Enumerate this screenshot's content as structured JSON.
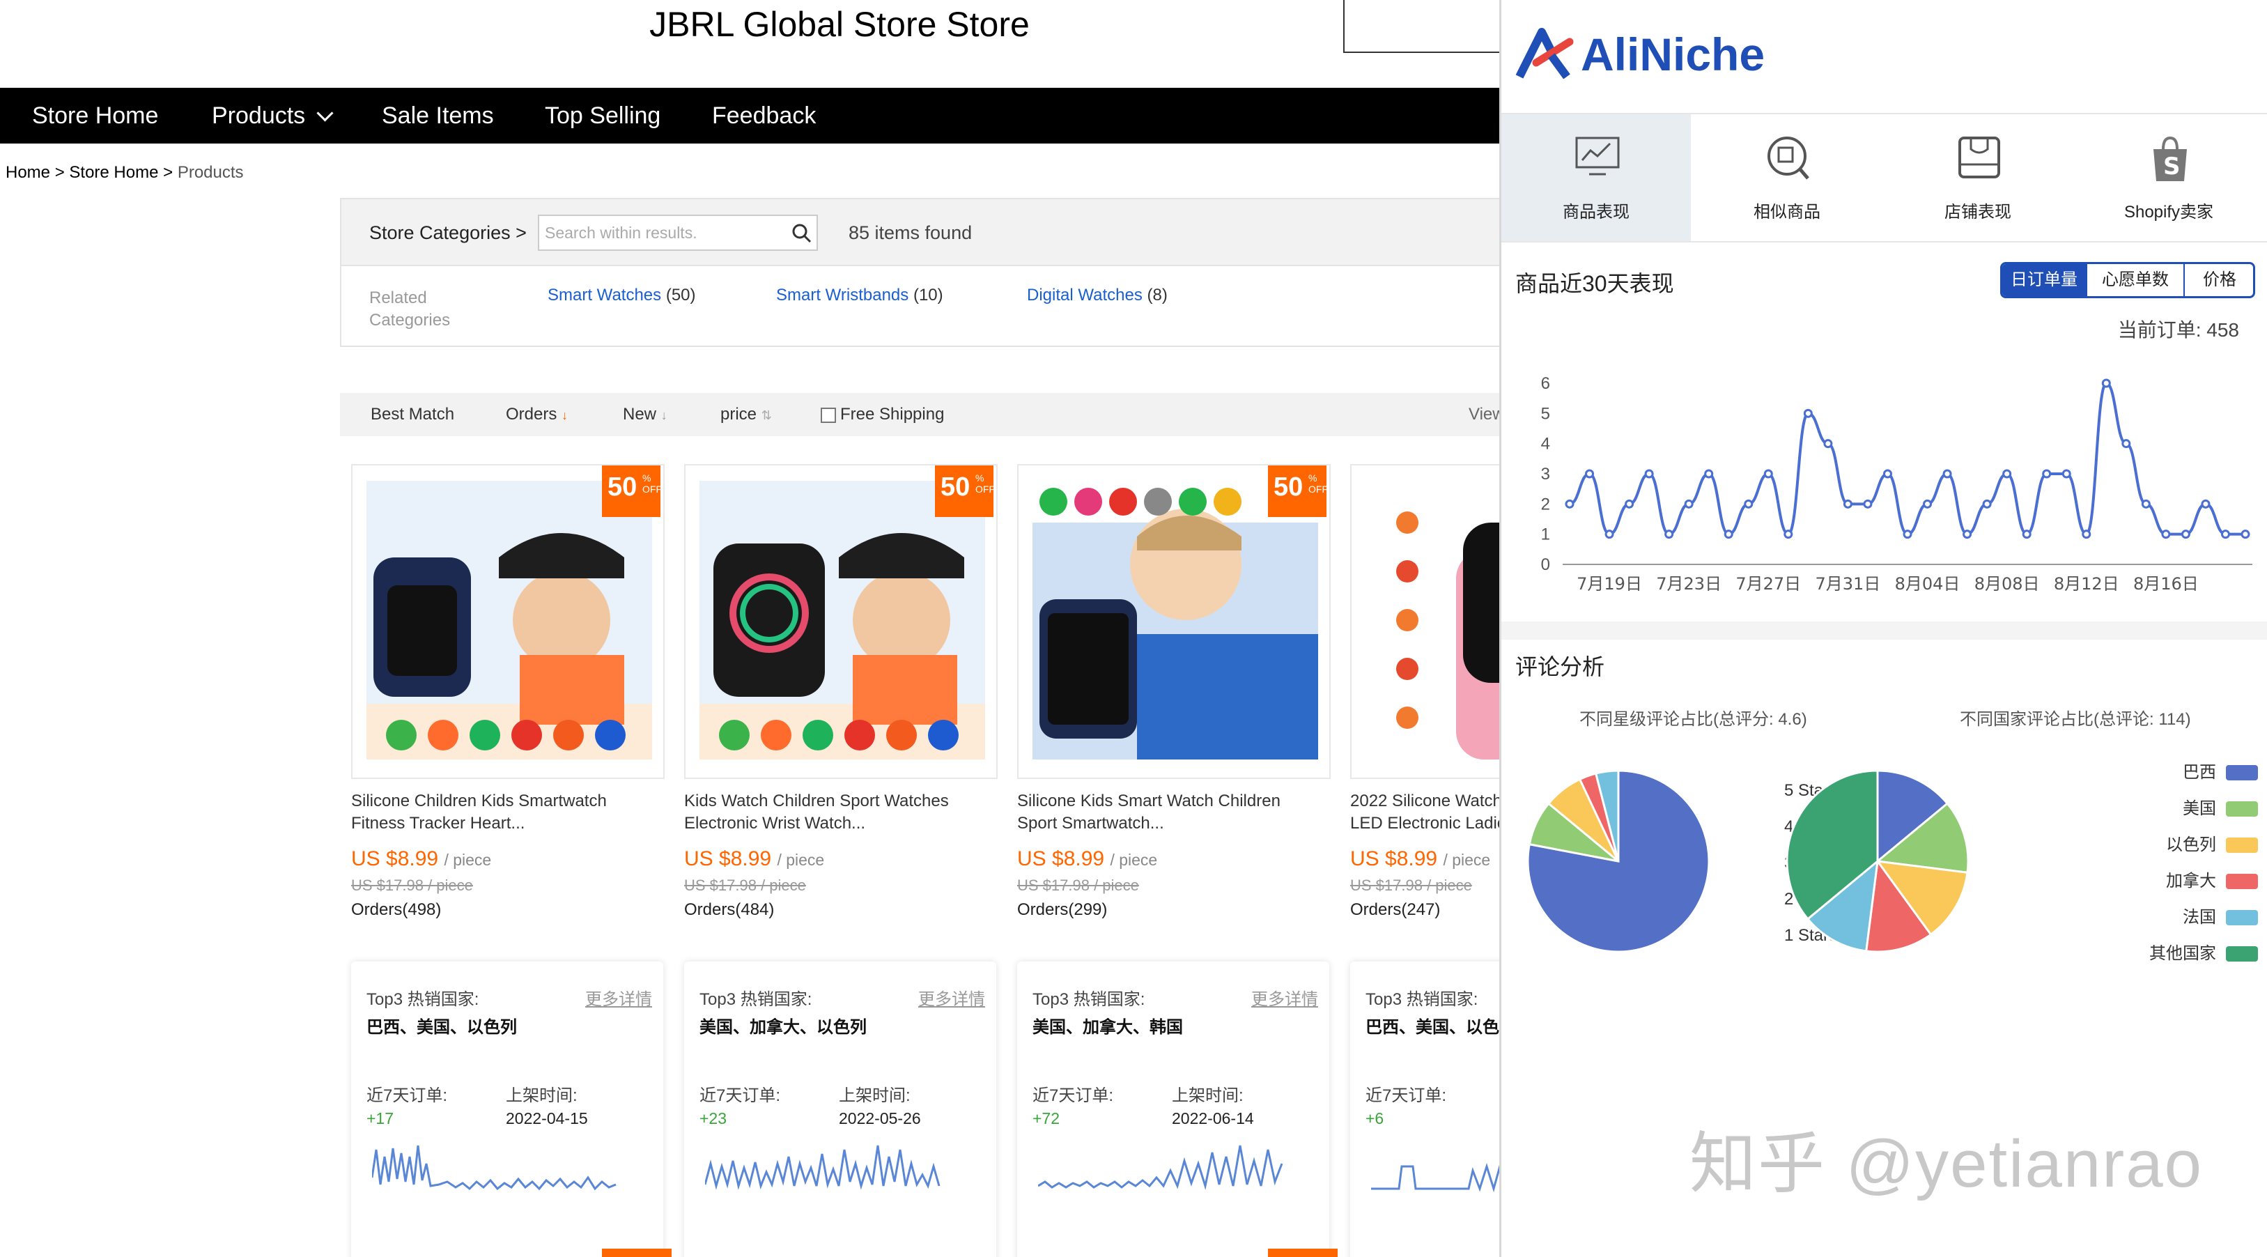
{
  "store": {
    "title": "JBRL Global Store Store",
    "nav": [
      "Store Home",
      "Products",
      "Sale Items",
      "Top Selling",
      "Feedback"
    ],
    "breadcrumb": {
      "home": "Home",
      "sep1": " > ",
      "store": "Store Home",
      "sep2": " > ",
      "current": "Products"
    },
    "categories_label": "Store Categories >",
    "search_placeholder": "Search within results.",
    "items_found": "85 items found",
    "related_label_1": "Related",
    "related_label_2": "Categories",
    "related": [
      {
        "name": "Smart Watches",
        "count": "(50)"
      },
      {
        "name": "Smart Wristbands",
        "count": "(10)"
      },
      {
        "name": "Digital Watches",
        "count": "(8)"
      }
    ],
    "sort": [
      "Best Match",
      "Orders",
      "New",
      "price"
    ],
    "free_shipping": "Free Shipping",
    "view": "View",
    "badge": {
      "num": "50",
      "pct": "%",
      "off": "OFF"
    },
    "price_unit": "/ piece",
    "products": [
      {
        "name1": "Silicone Children Kids Smartwatch",
        "name2": "Fitness Tracker Heart...",
        "price": "US $8.99",
        "old": "US $17.98 / piece",
        "orders": "Orders(498)"
      },
      {
        "name1": "Kids Watch Children Sport Watches",
        "name2": "Electronic Wrist Watch...",
        "price": "US $8.99",
        "old": "US $17.98 / piece",
        "orders": "Orders(484)"
      },
      {
        "name1": "Silicone Kids Smart Watch Children",
        "name2": "Sport Smartwatch...",
        "price": "US $8.99",
        "old": "US $17.98 / piece",
        "orders": "Orders(299)"
      },
      {
        "name1": "2022 Silicone Watch",
        "name2": "LED Electronic Ladie",
        "price": "US $8.99",
        "old": "US $17.98 / piece",
        "orders": "Orders(247)"
      }
    ],
    "detail_cards": [
      {
        "top3_label": "Top3 热销国家:",
        "more": "更多详情",
        "countries": "巴西、美国、以色列",
        "orders7_label": "近7天订单:",
        "orders7": "+17",
        "listed_label": "上架时间:",
        "listed": "2022-04-15"
      },
      {
        "top3_label": "Top3 热销国家:",
        "more": "更多详情",
        "countries": "美国、加拿大、以色列",
        "orders7_label": "近7天订单:",
        "orders7": "+23",
        "listed_label": "上架时间:",
        "listed": "2022-05-26"
      },
      {
        "top3_label": "Top3 热销国家:",
        "more": "更多详情",
        "countries": "美国、加拿大、韩国",
        "orders7_label": "近7天订单:",
        "orders7": "+72",
        "listed_label": "上架时间:",
        "listed": "2022-06-14"
      },
      {
        "top3_label": "Top3 热销国家:",
        "more": "",
        "countries": "巴西、美国、以色",
        "orders7_label": "近7天订单:",
        "orders7": "+6",
        "listed_label": "",
        "listed": ""
      }
    ]
  },
  "panel": {
    "logo": "AliNiche",
    "tabs": [
      "商品表现",
      "相似商品",
      "店铺表现",
      "Shopify卖家"
    ],
    "section_title": "商品近30天表现",
    "segments": [
      "日订单量",
      "心愿单数",
      "价格"
    ],
    "current_orders": "当前订单: 458",
    "review_title": "评论分析",
    "star_title": "不同星级评论占比(总评分: 4.6)",
    "country_title": "不同国家评论占比(总评论: 114)",
    "colors": {
      "accent": "#1f4fb6",
      "orange": "#ff6600",
      "line": "#4a6ed1"
    }
  },
  "watermark": "知乎 @yetianrao",
  "chart_data": [
    {
      "type": "line",
      "title": "商品近30天表现",
      "x": [
        "7月17日",
        "7月18日",
        "7月19日",
        "7月20日",
        "7月21日",
        "7月22日",
        "7月23日",
        "7月24日",
        "7月25日",
        "7月26日",
        "7月27日",
        "7月28日",
        "7月29日",
        "7月30日",
        "7月31日",
        "8月01日",
        "8月02日",
        "8月03日",
        "8月04日",
        "8月05日",
        "8月06日",
        "8月07日",
        "8月08日",
        "8月09日",
        "8月10日",
        "8月11日",
        "8月12日",
        "8月13日",
        "8月14日",
        "8月15日",
        "8月16日",
        "8月17日"
      ],
      "xticks": [
        "7月19日",
        "7月23日",
        "7月27日",
        "7月31日",
        "8月04日",
        "8月08日",
        "8月12日",
        "8月16日"
      ],
      "series": [
        {
          "values": [
            2,
            3,
            1,
            2,
            3,
            1,
            2,
            3,
            1,
            2,
            3,
            1,
            5,
            4,
            2,
            2,
            3,
            1,
            2,
            3,
            1,
            2,
            3,
            1,
            3,
            3,
            1,
            6,
            4,
            2,
            1,
            1,
            2,
            1,
            1
          ]
        }
      ],
      "ylim": [
        0,
        6
      ],
      "yticks": [
        0,
        1,
        2,
        3,
        4,
        5,
        6
      ],
      "grid": false
    },
    {
      "type": "pie",
      "title": "不同星级评论占比(总评分: 4.6)",
      "categories": [
        "5 Stars",
        "4 Stars",
        "3 Stars",
        "2 Stars",
        "1 Stars"
      ],
      "values": [
        78,
        8,
        7,
        3,
        4
      ],
      "colors": [
        "#5470c6",
        "#91cc75",
        "#fac858",
        "#ee6666",
        "#73c0de"
      ],
      "legend": "right"
    },
    {
      "type": "pie",
      "title": "不同国家评论占比(总评论: 114)",
      "categories": [
        "巴西",
        "美国",
        "以色列",
        "加拿大",
        "法国",
        "其他国家"
      ],
      "values": [
        14,
        13,
        13,
        12,
        12,
        36
      ],
      "colors": [
        "#5470c6",
        "#91cc75",
        "#fac858",
        "#ee6666",
        "#73c0de",
        "#3ba272"
      ],
      "legend": "left-of-labels"
    }
  ]
}
